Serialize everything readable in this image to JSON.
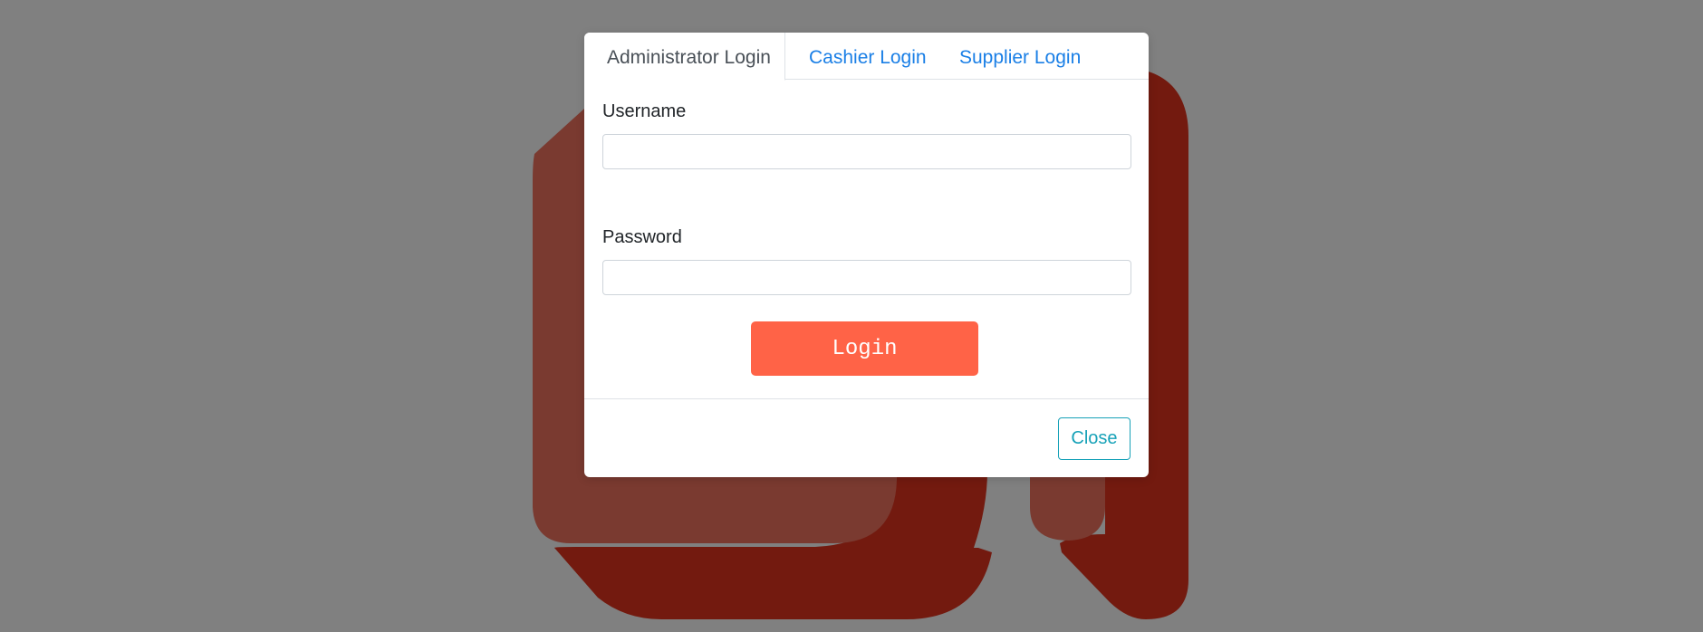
{
  "backdrop": {
    "color": "#808080",
    "logo_colors": {
      "light": "#7a3a30",
      "dark": "#731a0f"
    }
  },
  "modal": {
    "tabs": [
      {
        "label": "Administrator Login",
        "active": true
      },
      {
        "label": "Cashier Login",
        "active": false
      },
      {
        "label": "Supplier Login",
        "active": false
      }
    ],
    "username": {
      "label": "Username",
      "value": "",
      "placeholder": ""
    },
    "password": {
      "label": "Password",
      "value": "",
      "placeholder": ""
    },
    "login_button": {
      "label": "Login",
      "color": "#ff6347"
    },
    "close_button": {
      "label": "Close",
      "color": "#17a2b8"
    },
    "link_color": "#1a7fe6"
  }
}
